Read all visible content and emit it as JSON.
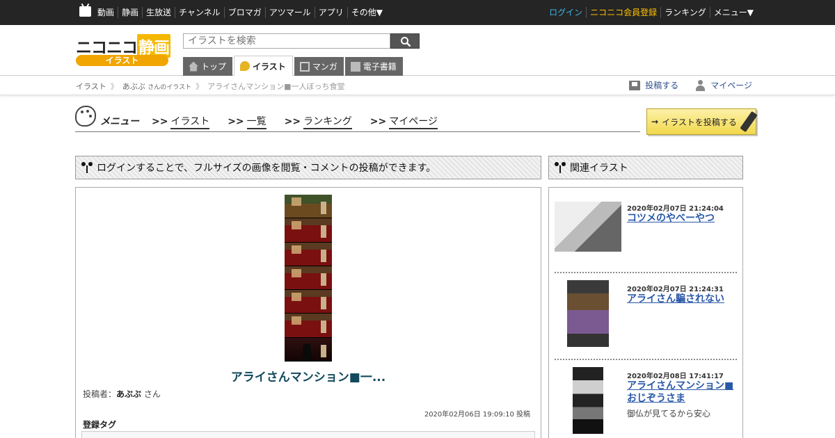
{
  "topnav": {
    "left": [
      "動画",
      "静画",
      "生放送",
      "チャンネル",
      "ブロマガ",
      "アツマール",
      "アプリ",
      "その他▼"
    ],
    "right": {
      "login": "ログイン",
      "register": "ニコニコ会員登録",
      "ranking": "ランキング",
      "menu": "メニュー▼"
    }
  },
  "header": {
    "logo_prefix": "ニコニコ",
    "logo_kanji": "静画",
    "logo_badge": "イラスト",
    "search_placeholder": "イラストを検索",
    "tabs": [
      "トップ",
      "イラスト",
      "マンガ",
      "電子書籍"
    ]
  },
  "breadcrumb": {
    "home": "イラスト",
    "user": "あぶぶ",
    "user_suffix": "さんのイラスト",
    "current": "アライさんマンション■一人ぼっち食堂",
    "post_label": "投稿する",
    "mypage_label": "マイページ"
  },
  "menu": {
    "title": "メニュー",
    "arrow": ">>",
    "links": [
      "イラスト",
      "一覧",
      "ランキング",
      "マイページ"
    ],
    "post_button": "イラストを投稿する"
  },
  "main": {
    "login_notice": "ログインすることで、フルサイズの画像を閲覧・コメントの投稿ができます。",
    "title": "アライさんマンション■一...",
    "poster_label": "投稿者：",
    "poster_name": "あぶぶ",
    "poster_suffix": "さん",
    "post_date": "2020年02月06日 19:09:10 投稿",
    "tag_label": "登録タグ"
  },
  "related": {
    "heading": "関連イラスト",
    "items": [
      {
        "date": "2020年02月07日 21:24:04",
        "title": "コツメのやべーやつ"
      },
      {
        "date": "2020年02月07日 21:24:31",
        "title": "アライさん騙されない"
      },
      {
        "date": "2020年02月08日 17:41:17",
        "title": "アライさんマンション■おじぞうさま",
        "desc": "御仏が見てるから安心"
      }
    ]
  }
}
